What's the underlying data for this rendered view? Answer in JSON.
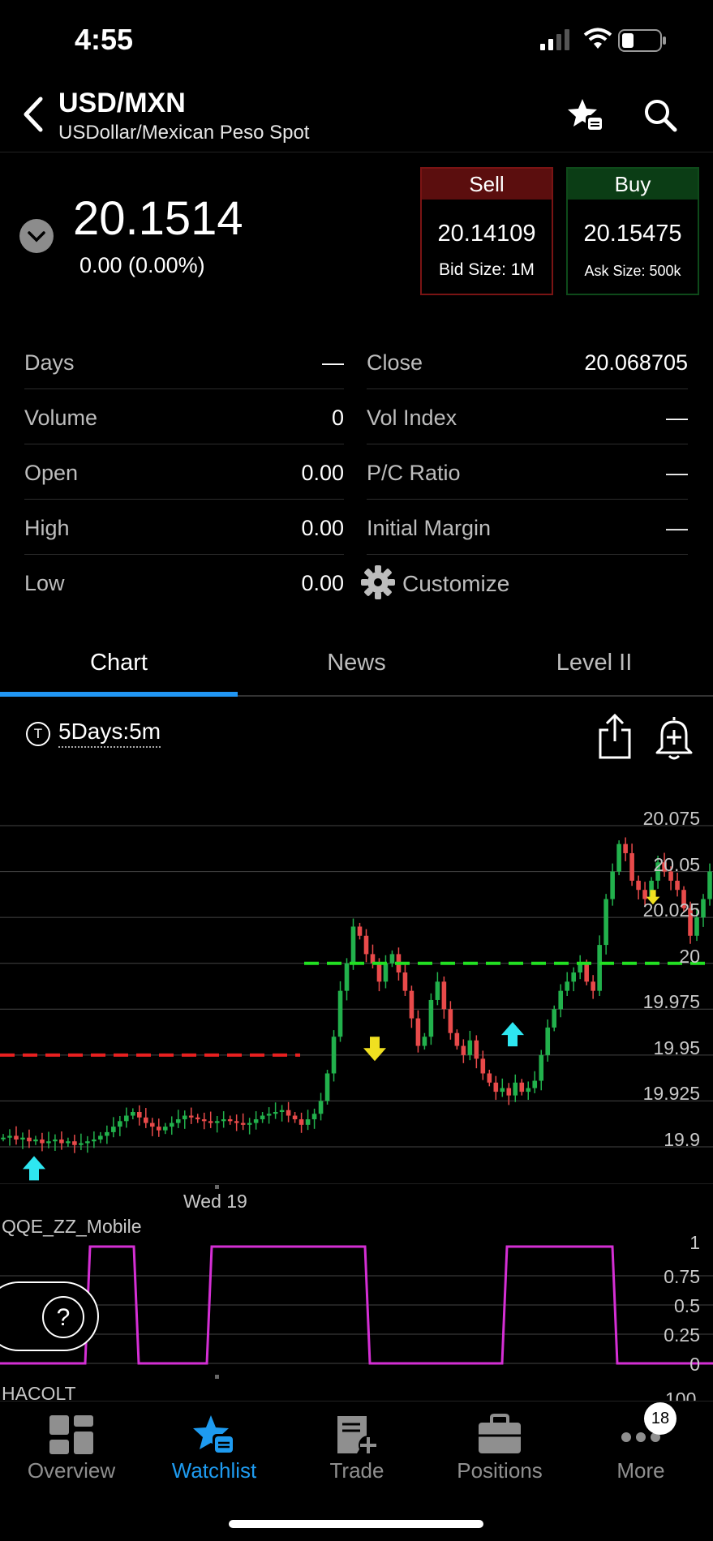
{
  "status": {
    "time": "4:55"
  },
  "header": {
    "symbol": "USD/MXN",
    "description": "USDollar/Mexican Peso Spot"
  },
  "quote": {
    "price": "20.1514",
    "change": "0.00 (0.00%)",
    "sell": {
      "label": "Sell",
      "price": "20.14109",
      "size": "Bid Size: 1M"
    },
    "buy": {
      "label": "Buy",
      "price": "20.15475",
      "size": "Ask Size: 500k"
    }
  },
  "stats": {
    "left": [
      {
        "label": "Days",
        "value": "—"
      },
      {
        "label": "Volume",
        "value": "0"
      },
      {
        "label": "Open",
        "value": "0.00"
      },
      {
        "label": "High",
        "value": "0.00"
      },
      {
        "label": "Low",
        "value": "0.00"
      }
    ],
    "right": [
      {
        "label": "Close",
        "value": "20.068705"
      },
      {
        "label": "Vol Index",
        "value": "—"
      },
      {
        "label": "P/C Ratio",
        "value": "—"
      },
      {
        "label": "Initial Margin",
        "value": "—"
      }
    ],
    "customize_label": "Customize"
  },
  "tabs": [
    {
      "label": "Chart",
      "active": true
    },
    {
      "label": "News",
      "active": false
    },
    {
      "label": "Level II",
      "active": false
    }
  ],
  "chart_toolbar": {
    "badge": "T",
    "period": "5Days:5m"
  },
  "colors": {
    "up": "#22b14c",
    "down": "#e84a4a",
    "accent": "#1e9bf0",
    "oscillator": "#d42fd4",
    "support": "#e82020",
    "resistance": "#22e022"
  },
  "chart_data": [
    {
      "type": "candlestick",
      "y_ticks": [
        "20.075",
        "20.05",
        "20.025",
        "20",
        "19.975",
        "19.95",
        "19.925",
        "19.9"
      ],
      "x_label": "Wed 19",
      "ylim": [
        19.875,
        20.1
      ],
      "ref_lines": [
        {
          "value": 19.95,
          "style": "dashed",
          "color": "red"
        },
        {
          "value": 20.0,
          "style": "dashed",
          "color": "green"
        }
      ],
      "markers": [
        {
          "type": "up-arrow",
          "value": 19.895
        },
        {
          "type": "down-arrow",
          "value": 19.96
        },
        {
          "type": "up-arrow",
          "value": 19.968
        },
        {
          "type": "down-arrow",
          "value": 20.04
        }
      ],
      "closes": [
        19.905,
        19.906,
        19.904,
        19.905,
        19.903,
        19.904,
        19.902,
        19.903,
        19.904,
        19.902,
        19.903,
        19.901,
        19.902,
        19.903,
        19.904,
        19.906,
        19.908,
        19.911,
        19.914,
        19.917,
        19.919,
        19.916,
        19.913,
        19.911,
        19.909,
        19.911,
        19.913,
        19.915,
        19.917,
        19.916,
        19.915,
        19.914,
        19.913,
        19.914,
        19.915,
        19.914,
        19.913,
        19.912,
        19.913,
        19.915,
        19.917,
        19.918,
        19.919,
        19.92,
        19.917,
        19.915,
        19.912,
        19.915,
        19.918,
        19.925,
        19.94,
        19.96,
        19.985,
        20.0,
        20.02,
        20.015,
        20.005,
        20.0,
        19.99,
        20.0,
        20.005,
        19.995,
        19.985,
        19.97,
        19.955,
        19.96,
        19.98,
        19.99,
        19.975,
        19.962,
        19.955,
        19.95,
        19.958,
        19.948,
        19.94,
        19.935,
        19.93,
        19.932,
        19.928,
        19.935,
        19.93,
        19.932,
        19.936,
        19.95,
        19.965,
        19.975,
        19.985,
        19.99,
        19.995,
        20.0,
        19.99,
        19.985,
        20.01,
        20.035,
        20.05,
        20.065,
        20.06,
        20.045,
        20.04,
        20.035,
        20.045,
        20.055,
        20.05,
        20.045,
        20.04,
        20.03,
        20.015,
        20.025,
        20.035,
        20.05
      ]
    },
    {
      "type": "line",
      "title": "QQE_ZZ_Mobile",
      "y_ticks": [
        "1",
        "0.75",
        "0.5",
        "0.25",
        "0"
      ],
      "ylim": [
        0,
        1
      ],
      "steps": [
        [
          0,
          0
        ],
        [
          108,
          1
        ],
        [
          168,
          0
        ],
        [
          258,
          1
        ],
        [
          453,
          0
        ],
        [
          622,
          1
        ],
        [
          758,
          0
        ],
        [
          879,
          0
        ]
      ]
    },
    {
      "type": "line",
      "title": "HACOLT",
      "y_ticks": [
        "100"
      ]
    }
  ],
  "nav": [
    {
      "label": "Overview",
      "icon": "overview-icon",
      "active": false
    },
    {
      "label": "Watchlist",
      "icon": "watchlist-icon",
      "active": true
    },
    {
      "label": "Trade",
      "icon": "trade-icon",
      "active": false
    },
    {
      "label": "Positions",
      "icon": "positions-icon",
      "active": false
    },
    {
      "label": "More",
      "icon": "more-icon",
      "active": false
    }
  ],
  "more_badge": "18",
  "help_label": "?"
}
